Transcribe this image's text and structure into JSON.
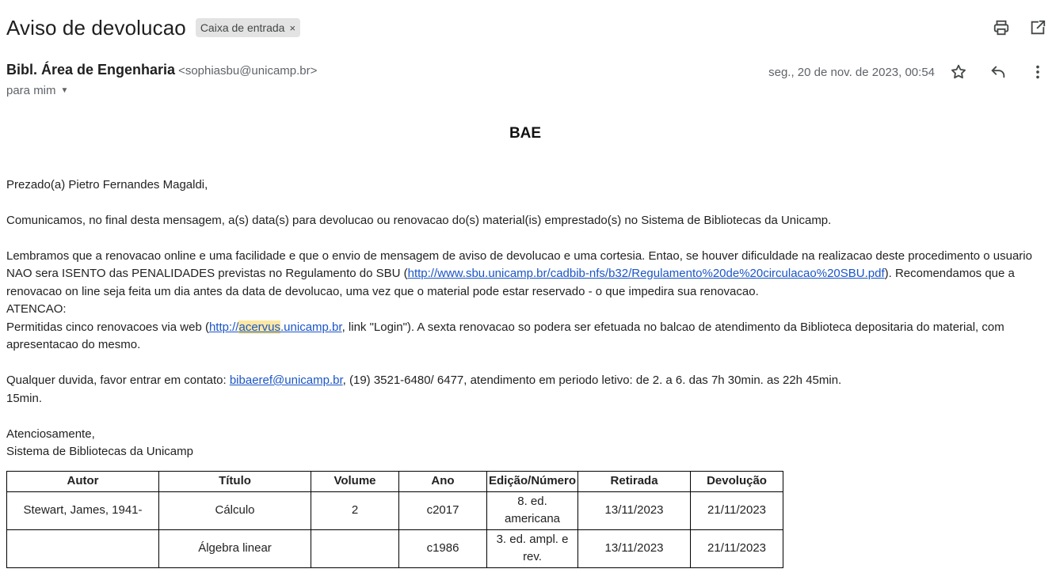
{
  "header": {
    "subject": "Aviso de devolucao",
    "label": "Caixa de entrada",
    "label_close": "×"
  },
  "toolbar_icons": [
    "print-icon",
    "open-in-new-window-icon"
  ],
  "message": {
    "sender_name": "Bibl. Área de Engenharia",
    "sender_email": "<sophiasbu@unicamp.br>",
    "to": "para mim",
    "date": "seg., 20 de nov. de 2023, 00:54",
    "action_icons": [
      "star-icon",
      "reply-icon",
      "more-vert-icon"
    ]
  },
  "content": {
    "heading": "BAE",
    "greeting": "Prezado(a) Pietro Fernandes Magaldi,",
    "p1": "Comunicamos, no final desta mensagem, a(s) data(s) para devolucao ou renovacao do(s) material(is) emprestado(s) no Sistema de Bibliotecas da Unicamp.",
    "p2_a": "Lembramos que a renovacao online e uma facilidade e que o envio de mensagem de aviso de devolucao e uma cortesia. Entao, se houver dificuldade na realizacao deste procedimento o usuario NAO sera ISENTO das PENALIDADES previstas no Regulamento do SBU (",
    "p2_link": "http://www.sbu.unicamp.br/cadbib-nfs/b32/Regulamento%20de%20circulacao%20SBU.pdf",
    "p2_b": "). Recomendamos que a renovacao on line seja feita um dia antes da data de devolucao, uma vez que o material pode estar reservado - o que impedira sua renovacao.",
    "attention": "ATENCAO:",
    "p3_a": "Permitidas cinco renovacoes via web (",
    "p3_link_a": "http://",
    "p3_link_hl": "acervus",
    "p3_link_b": ".unicamp.br",
    "p3_b": ", link \"Login\"). A sexta renovacao so podera ser efetuada no balcao de atendimento da Biblioteca depositaria do material, com apresentacao do mesmo.",
    "p4_a": "Qualquer duvida, favor entrar em contato: ",
    "p4_link": "bibaeref@unicamp.br",
    "p4_b": ", (19) 3521-6480/ 6477, atendimento em periodo letivo: de 2. a 6. das 7h 30min. as 22h 45min.",
    "p4_c": "15min.",
    "closing": "Atenciosamente,",
    "signature": "Sistema de Bibliotecas da Unicamp"
  },
  "table": {
    "headers": [
      "Autor",
      "Título",
      "Volume",
      "Ano",
      "Edição/Número",
      "Retirada",
      "Devolução"
    ],
    "rows": [
      [
        "Stewart, James, 1941-",
        "Cálculo",
        "2",
        "c2017",
        "8. ed. americana",
        "13/11/2023",
        "21/11/2023"
      ],
      [
        "",
        "Álgebra linear",
        "",
        "c1986",
        "3. ed. ampl. e rev.",
        "13/11/2023",
        "21/11/2023"
      ]
    ]
  }
}
